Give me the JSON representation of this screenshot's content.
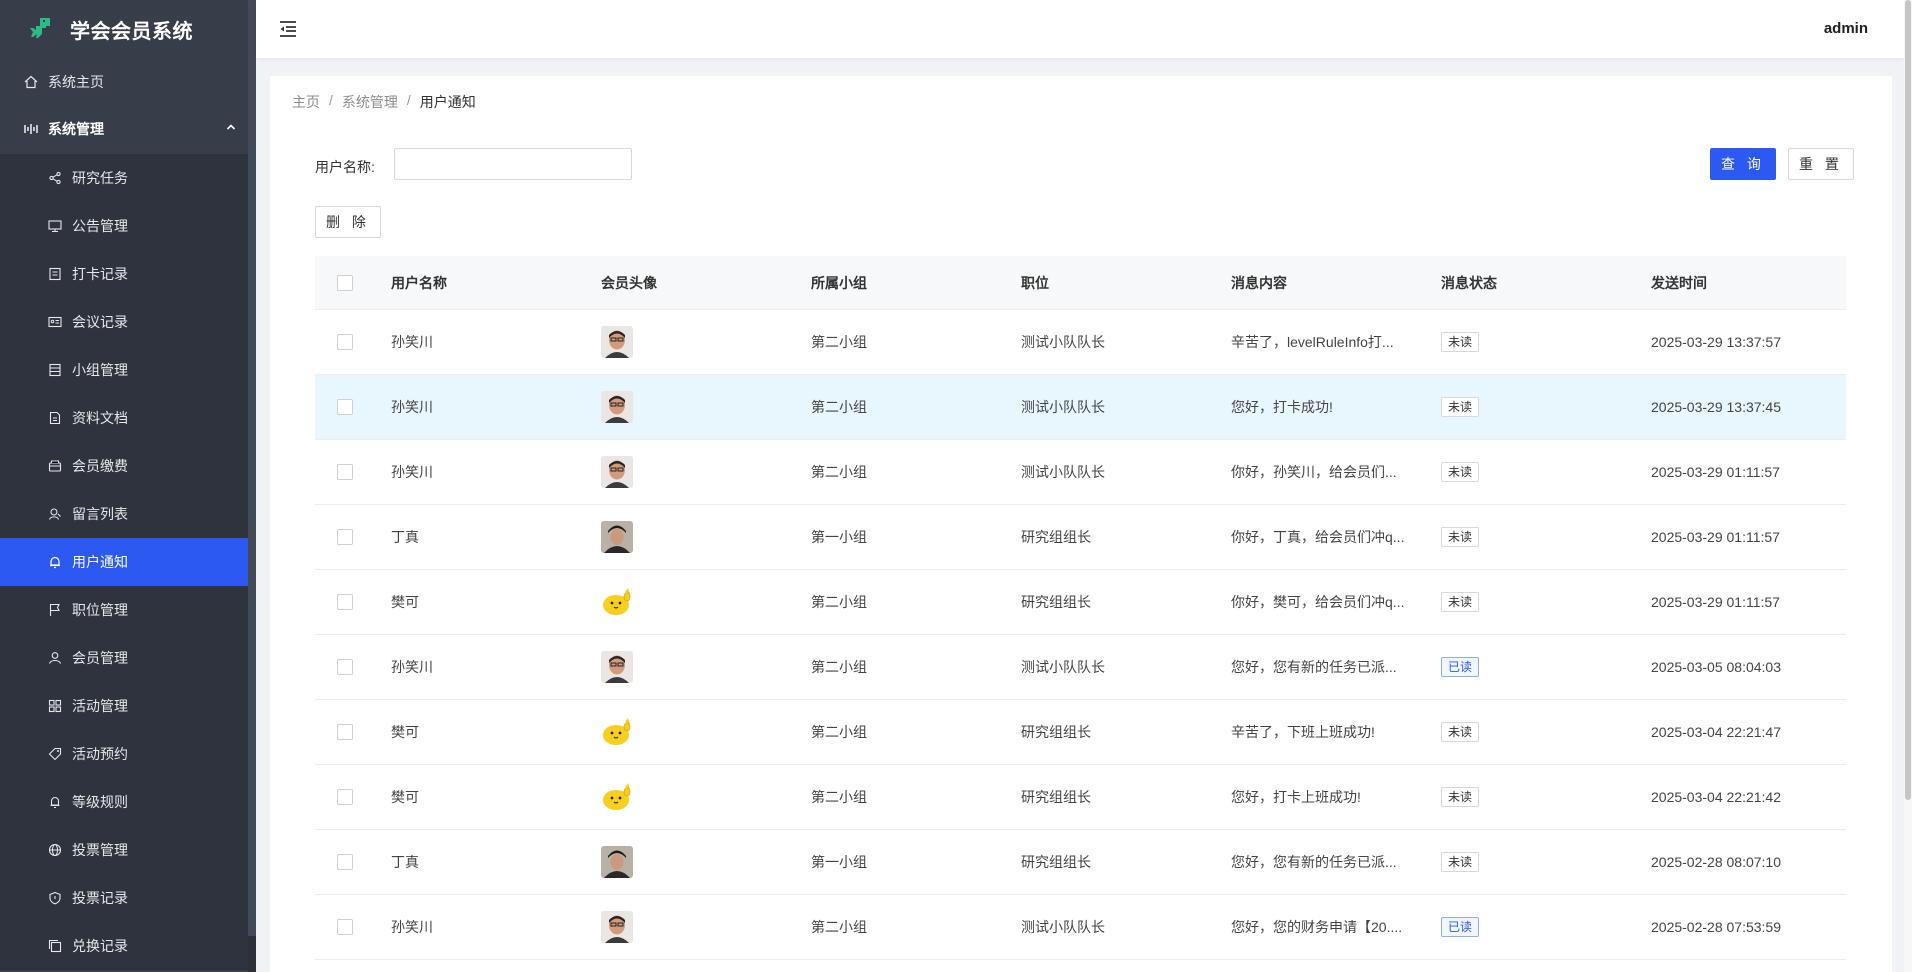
{
  "app": {
    "title": "学会会员系统",
    "user": "admin"
  },
  "colors": {
    "accent": "#2b59f1",
    "sidebar": "#373d49",
    "submenu": "#2e333d"
  },
  "sidebar": {
    "home": {
      "label": "系统主页",
      "icon": "home-icon"
    },
    "group": {
      "label": "系统管理",
      "icon": "settings-icon"
    },
    "items": [
      {
        "label": "研究任务",
        "icon": "share-icon"
      },
      {
        "label": "公告管理",
        "icon": "monitor-icon"
      },
      {
        "label": "打卡记录",
        "icon": "clipboard-icon"
      },
      {
        "label": "会议记录",
        "icon": "id-card-icon"
      },
      {
        "label": "小组管理",
        "icon": "list-icon"
      },
      {
        "label": "资料文档",
        "icon": "document-icon"
      },
      {
        "label": "会员缴费",
        "icon": "wallet-icon"
      },
      {
        "label": "留言列表",
        "icon": "message-icon"
      },
      {
        "label": "用户通知",
        "icon": "bell-icon",
        "active": true
      },
      {
        "label": "职位管理",
        "icon": "flag-icon"
      },
      {
        "label": "会员管理",
        "icon": "user-icon"
      },
      {
        "label": "活动管理",
        "icon": "grid-icon"
      },
      {
        "label": "活动预约",
        "icon": "tag-icon"
      },
      {
        "label": "等级规则",
        "icon": "bell-outline-icon"
      },
      {
        "label": "投票管理",
        "icon": "globe-icon"
      },
      {
        "label": "投票记录",
        "icon": "shield-icon"
      },
      {
        "label": "兑换记录",
        "icon": "copy-icon"
      }
    ]
  },
  "breadcrumb": [
    "主页",
    "系统管理",
    "用户通知"
  ],
  "search": {
    "label": "用户名称:",
    "value": "",
    "placeholder": ""
  },
  "buttons": {
    "query": "查 询",
    "reset": "重 置",
    "delete": "删 除"
  },
  "table": {
    "headers": [
      "用户名称",
      "会员头像",
      "所属小组",
      "职位",
      "消息内容",
      "消息状态",
      "发送时间"
    ],
    "rows": [
      {
        "name": "孙笑川",
        "avatar": "man-glasses",
        "group": "第二小组",
        "position": "测试小队队长",
        "message": "辛苦了，levelRuleInfo打...",
        "status": "未读",
        "read": false,
        "time": "2025-03-29 13:37:57"
      },
      {
        "name": "孙笑川",
        "avatar": "man-glasses",
        "group": "第二小组",
        "position": "测试小队队长",
        "message": "您好，打卡成功!",
        "status": "未读",
        "read": false,
        "time": "2025-03-29 13:37:45",
        "hover": true
      },
      {
        "name": "孙笑川",
        "avatar": "man-glasses",
        "group": "第二小组",
        "position": "测试小队队长",
        "message": "你好，孙笑川，给会员们...",
        "status": "未读",
        "read": false,
        "time": "2025-03-29 01:11:57"
      },
      {
        "name": "丁真",
        "avatar": "boy-hat",
        "group": "第一小组",
        "position": "研究组组长",
        "message": "你好，丁真，给会员们冲q...",
        "status": "未读",
        "read": false,
        "time": "2025-03-29 01:11:57"
      },
      {
        "name": "樊可",
        "avatar": "yellow-chick",
        "group": "第二小组",
        "position": "研究组组长",
        "message": "你好，樊可，给会员们冲q...",
        "status": "未读",
        "read": false,
        "time": "2025-03-29 01:11:57"
      },
      {
        "name": "孙笑川",
        "avatar": "man-glasses",
        "group": "第二小组",
        "position": "测试小队队长",
        "message": "您好，您有新的任务已派...",
        "status": "已读",
        "read": true,
        "time": "2025-03-05 08:04:03"
      },
      {
        "name": "樊可",
        "avatar": "yellow-chick",
        "group": "第二小组",
        "position": "研究组组长",
        "message": "辛苦了，下班上班成功!",
        "status": "未读",
        "read": false,
        "time": "2025-03-04 22:21:47"
      },
      {
        "name": "樊可",
        "avatar": "yellow-chick",
        "group": "第二小组",
        "position": "研究组组长",
        "message": "您好，打卡上班成功!",
        "status": "未读",
        "read": false,
        "time": "2025-03-04 22:21:42"
      },
      {
        "name": "丁真",
        "avatar": "boy-hat",
        "group": "第一小组",
        "position": "研究组组长",
        "message": "您好，您有新的任务已派...",
        "status": "未读",
        "read": false,
        "time": "2025-02-28 08:07:10"
      },
      {
        "name": "孙笑川",
        "avatar": "man-glasses",
        "group": "第二小组",
        "position": "测试小队队长",
        "message": "您好，您的财务申请【20....",
        "status": "已读",
        "read": true,
        "time": "2025-02-28 07:53:59"
      }
    ]
  }
}
